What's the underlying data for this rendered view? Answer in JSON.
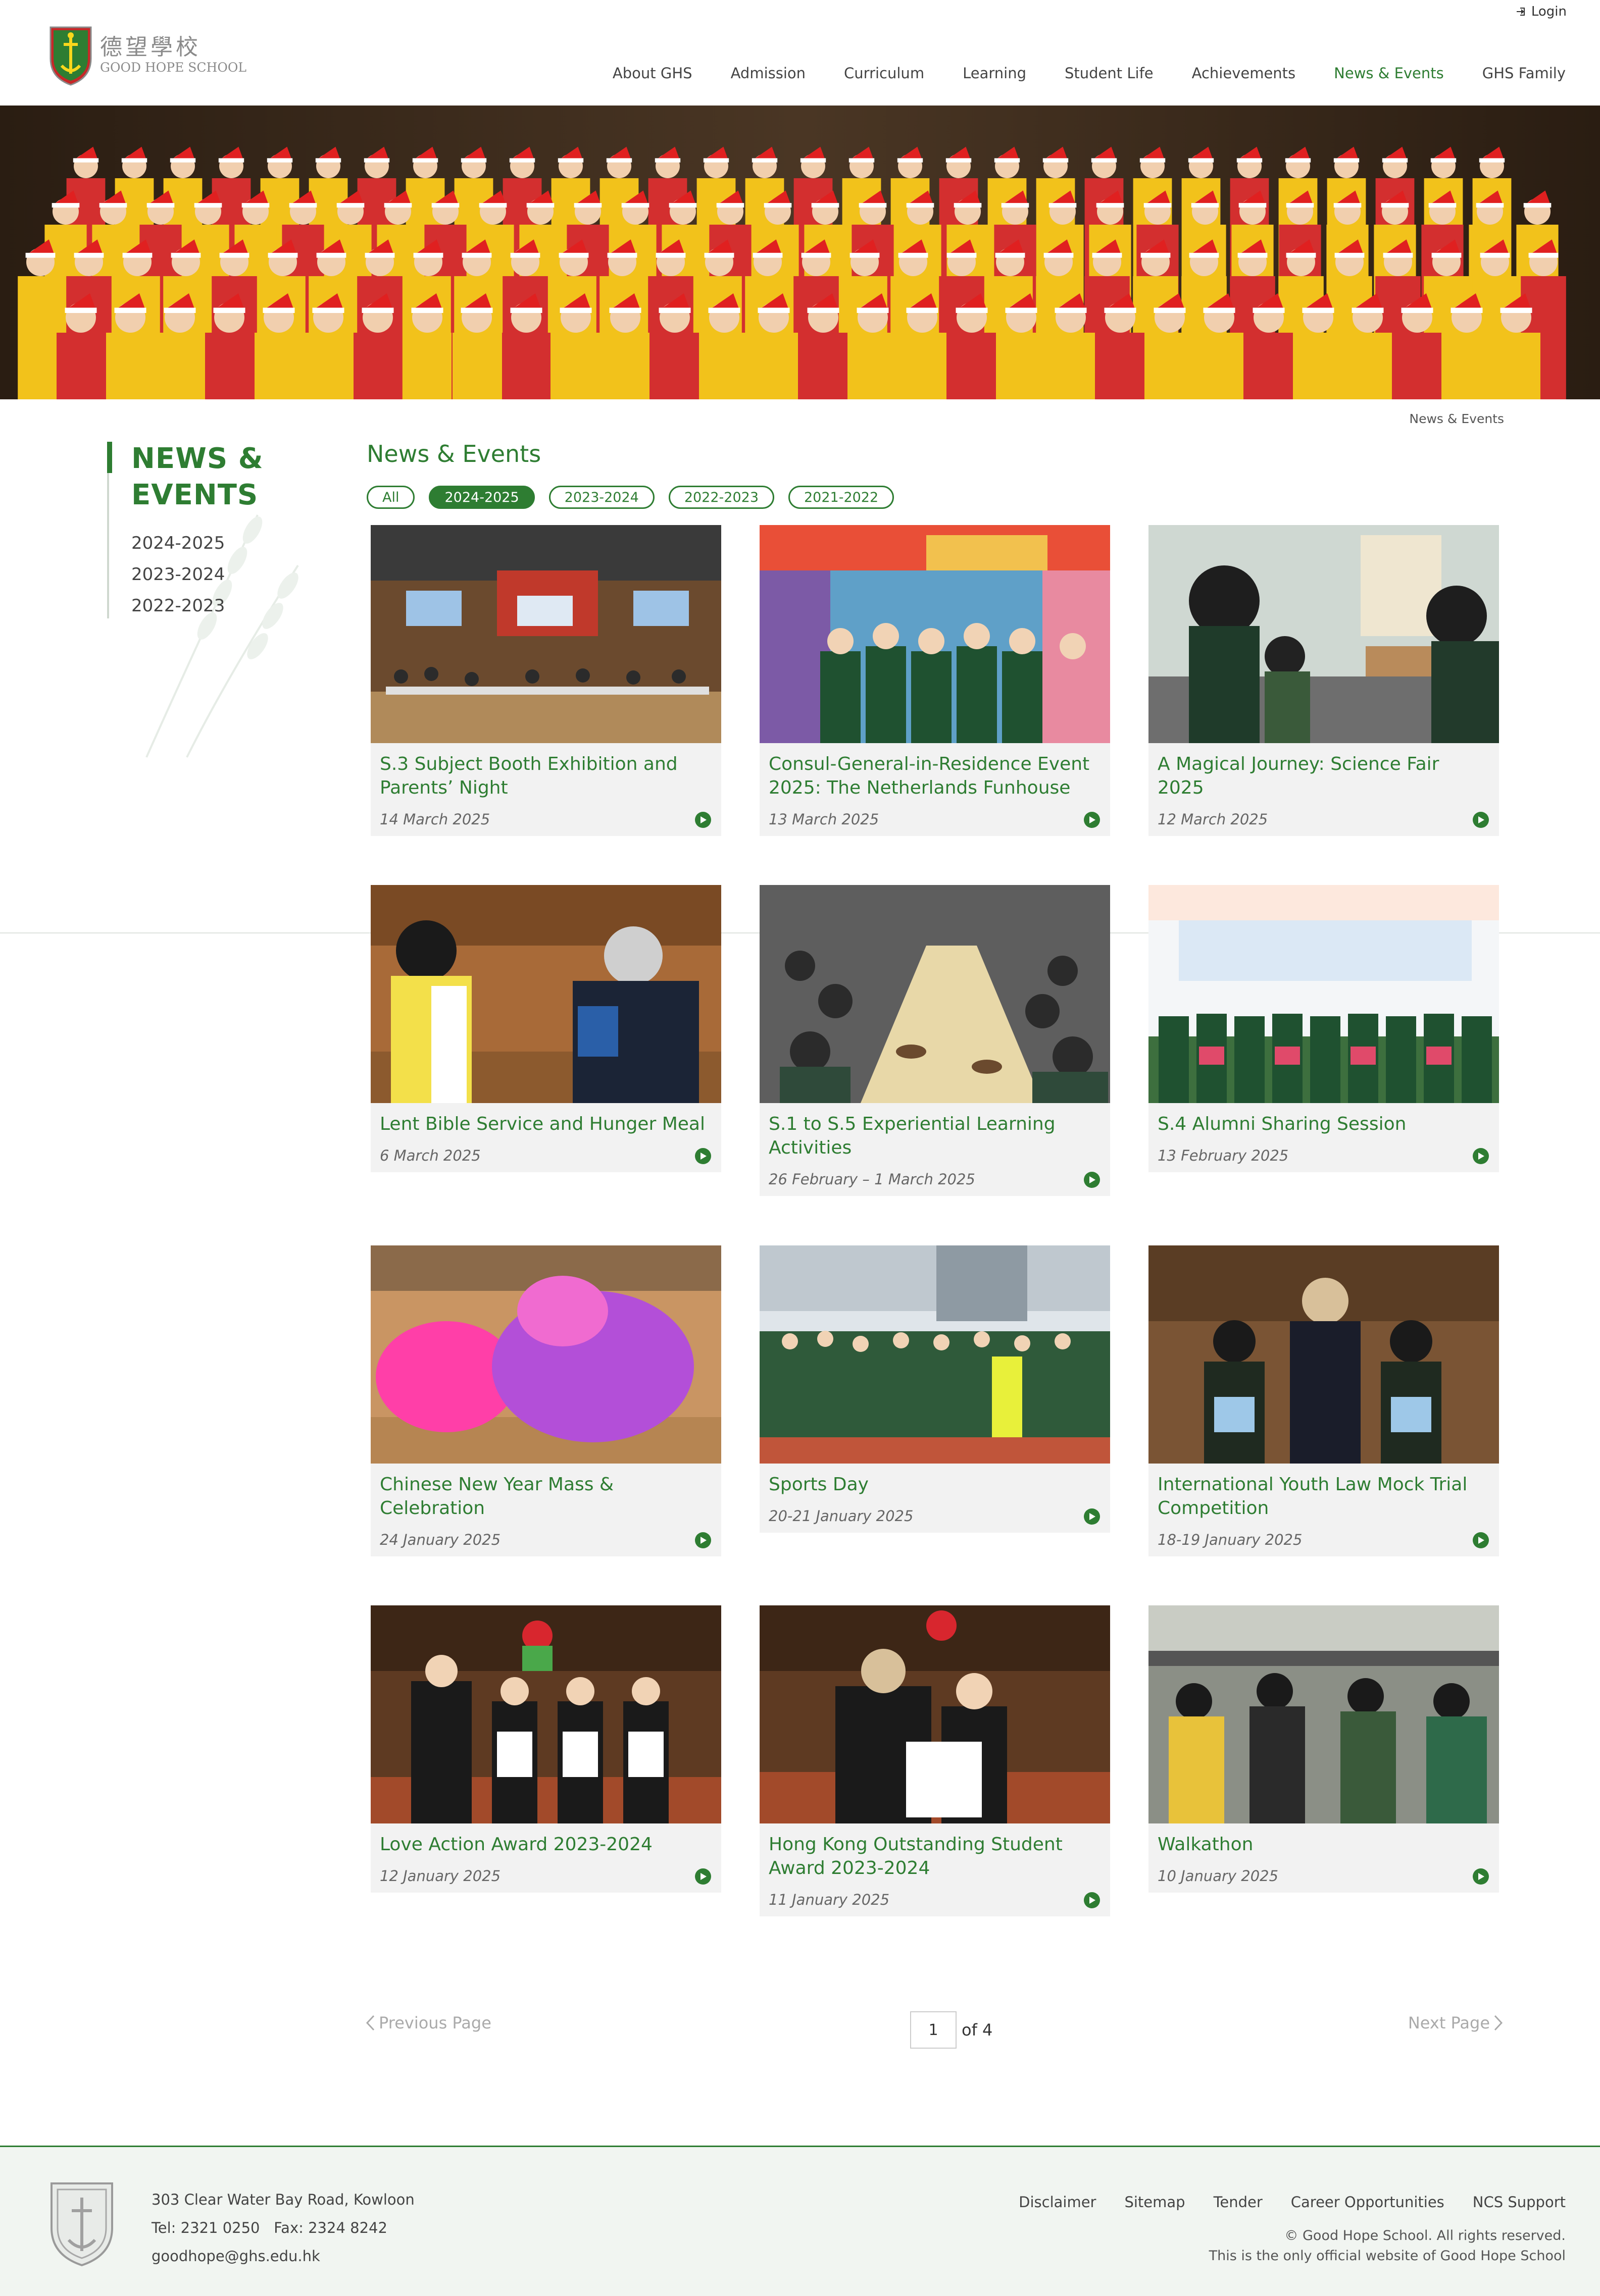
{
  "header": {
    "login_label": "Login",
    "logo_cn": "德望學校",
    "logo_en": "GOOD HOPE SCHOOL",
    "nav": [
      {
        "label": "About GHS"
      },
      {
        "label": "Admission"
      },
      {
        "label": "Curriculum"
      },
      {
        "label": "Learning"
      },
      {
        "label": "Student Life"
      },
      {
        "label": "Achievements"
      },
      {
        "label": "News & Events",
        "active": true
      },
      {
        "label": "GHS Family"
      }
    ]
  },
  "breadcrumb": "News & Events",
  "sidebar": {
    "title_line1": "NEWS &",
    "title_line2": "EVENTS",
    "items": [
      "2024-2025",
      "2023-2024",
      "2022-2023"
    ]
  },
  "main": {
    "title": "News & Events",
    "filters": [
      {
        "label": "All",
        "active": false
      },
      {
        "label": "2024-2025",
        "active": true
      },
      {
        "label": "2023-2024",
        "active": false
      },
      {
        "label": "2022-2023",
        "active": false
      },
      {
        "label": "2021-2022",
        "active": false
      }
    ]
  },
  "cards": [
    {
      "title": "S.3 Subject Booth Exhibition and Parents’ Night",
      "date": "14 March 2025",
      "image": "school-hall-meeting"
    },
    {
      "title": "Consul-General-in-Residence Event 2025: The Netherlands Funhouse",
      "date": "13 March 2025",
      "image": "funhouse-group"
    },
    {
      "title": "A Magical Journey: Science Fair 2025",
      "date": "12 March 2025",
      "image": "science-fair"
    },
    {
      "title": "Lent Bible Service and Hunger Meal",
      "date": "6 March 2025",
      "image": "ash-blessing"
    },
    {
      "title": "S.1 to S.5 Experiential Learning Activities",
      "date": "26 February – 1 March 2025",
      "image": "workshop-tables"
    },
    {
      "title": "S.4 Alumni Sharing Session",
      "date": "13 February 2025",
      "image": "alumni-sharing"
    },
    {
      "title": "Chinese New Year Mass & Celebration",
      "date": "24 January 2025",
      "image": "lion-dance"
    },
    {
      "title": "Sports Day",
      "date": "20-21 January 2025",
      "image": "sports-day-crowd"
    },
    {
      "title": "International Youth Law Mock Trial Competition",
      "date": "18-19 January 2025",
      "image": "award-trio"
    },
    {
      "title": "Love Action Award 2023-2024",
      "date": "12 January 2025",
      "image": "award-group"
    },
    {
      "title": "Hong Kong Outstanding Student Award 2023-2024",
      "date": "11 January 2025",
      "image": "award-pair"
    },
    {
      "title": "Walkathon",
      "date": "10 January 2025",
      "image": "walkathon"
    }
  ],
  "pagination": {
    "prev_label": "Previous Page",
    "next_label": "Next Page",
    "current_page": "1",
    "of_label": "of 4"
  },
  "footer": {
    "address": "303 Clear Water Bay Road, Kowloon",
    "phone": "Tel: 2321 0250   Fax: 2324 8242",
    "email": "goodhope@ghs.edu.hk",
    "links": [
      "Disclaimer",
      "Sitemap",
      "Tender",
      "Career Opportunities",
      "NCS Support"
    ],
    "copyright": "© Good Hope School. All rights reserved.",
    "official_note": "This is the only official website of Good Hope School"
  },
  "colors": {
    "brand_green": "#2e7d32",
    "footer_bg": "#f1f5f1",
    "card_bg": "#f2f2f2"
  }
}
